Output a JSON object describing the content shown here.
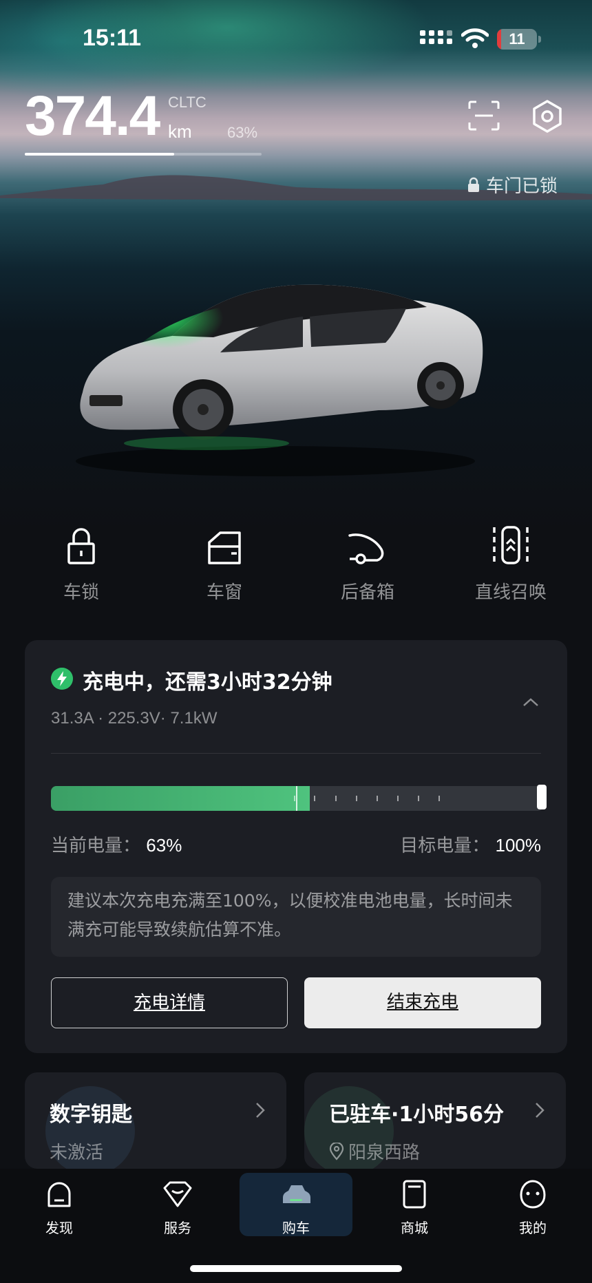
{
  "status_bar": {
    "time": "15:11",
    "battery": "11",
    "battery_level": 0.11
  },
  "range": {
    "value": "374.4",
    "standard": "CLTC",
    "unit": "km",
    "battery_percent": "63%",
    "battery_fraction": 0.63
  },
  "lock_status": "车门已锁",
  "controls": [
    {
      "label": "车锁",
      "icon": "lock-icon"
    },
    {
      "label": "车窗",
      "icon": "window-icon"
    },
    {
      "label": "后备箱",
      "icon": "trunk-icon"
    },
    {
      "label": "直线召唤",
      "icon": "summon-icon"
    }
  ],
  "charging": {
    "title": "充电中，还需3小时32分钟",
    "stats": "31.3A · 225.3V· 7.1kW",
    "current_label": "当前电量：",
    "current_value": "63%",
    "current_fraction": 0.63,
    "target_label": "目标电量：",
    "target_value": "100%",
    "target_fraction": 1.0,
    "tip": "建议本次充电充满至100%，以便校准电池电量，长时间未满充可能导致续航估算不准。",
    "detail_button": "充电详情",
    "stop_button": "结束充电"
  },
  "digital_key": {
    "title": "数字钥匙",
    "status": "未激活"
  },
  "parking": {
    "title": "已驻车·1小时56分",
    "location": "阳泉西路"
  },
  "tabs": [
    {
      "label": "发现",
      "icon": "discover-icon",
      "active": false
    },
    {
      "label": "服务",
      "icon": "service-icon",
      "active": false
    },
    {
      "label": "购车",
      "icon": "car-icon",
      "active": true
    },
    {
      "label": "商城",
      "icon": "mall-icon",
      "active": false
    },
    {
      "label": "我的",
      "icon": "profile-icon",
      "active": false
    }
  ],
  "colors": {
    "charge_green": "#4fc37e",
    "active_tab_bg": "#15273a",
    "battery_red": "#e23c3c"
  }
}
